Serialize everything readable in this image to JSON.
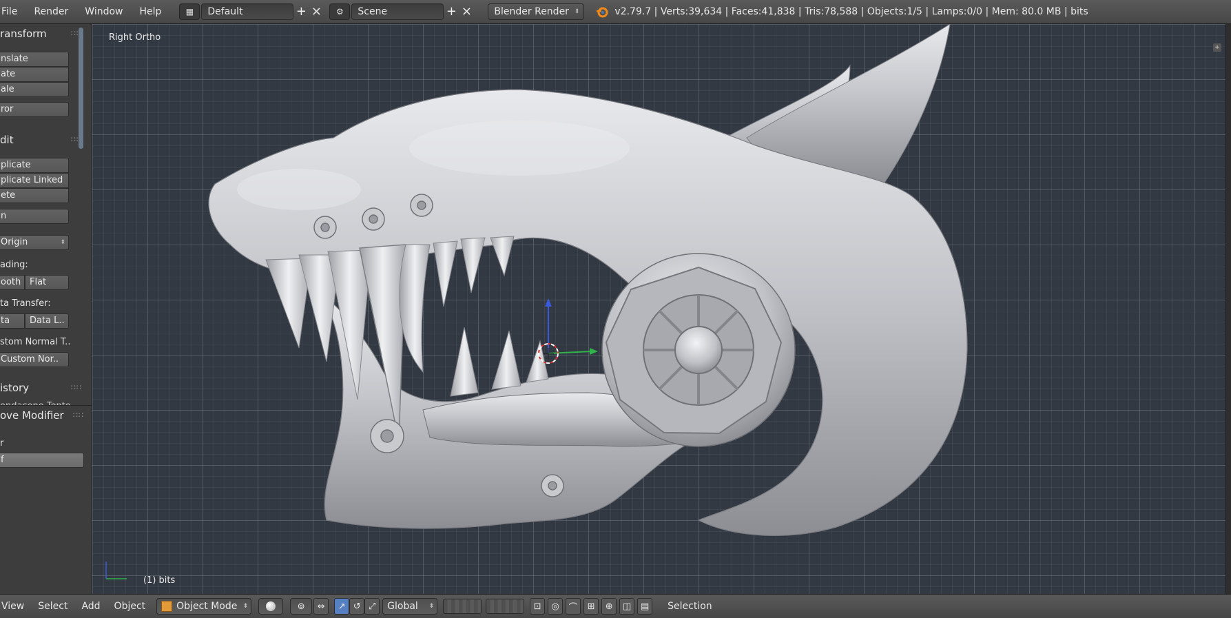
{
  "top_menu": {
    "items": [
      "File",
      "Render",
      "Window",
      "Help"
    ],
    "layout_name": "Default",
    "scene_name": "Scene",
    "render_engine": "Blender Render",
    "stats": "v2.79.7 | Verts:39,634 | Faces:41,838 | Tris:78,588 | Objects:1/5 | Lamps:0/0 | Mem: 80.0 MB | bits"
  },
  "tool_shelf": {
    "transform": {
      "header": "ransform",
      "translate": "nslate",
      "rotate": "ate",
      "scale": "ale",
      "mirror": "ror"
    },
    "edit": {
      "header": "dit",
      "duplicate": "plicate",
      "duplicate_linked": "plicate Linked",
      "delete": "ete",
      "join": "n",
      "set_origin": "Origin",
      "shading_label": "ading:",
      "smooth": "ooth",
      "flat": "Flat",
      "data_transfer_label": "ta Transfer:",
      "data": "ta",
      "data_layout": "Data L..",
      "custom_normal_label": "stom Normal T..",
      "custom_normal_button": "Custom Nor.."
    },
    "history": {
      "header": "istory",
      "cut_text": "ondacono Tonto"
    },
    "operator": {
      "header": "ove Modifier",
      "label": "r",
      "field": "f"
    }
  },
  "viewport": {
    "view_name": "Right Ortho",
    "object_label": "(1) bits"
  },
  "bottom_bar": {
    "menus": [
      "View",
      "Select",
      "Add",
      "Object"
    ],
    "mode": "Object Mode",
    "orientation": "Global",
    "snap_target": "Selection"
  },
  "colors": {
    "header_bg": "#4e4e4e",
    "viewport_bg": "#333942",
    "accent_active": "#5680c2",
    "model_base": "#c6c8cd"
  }
}
